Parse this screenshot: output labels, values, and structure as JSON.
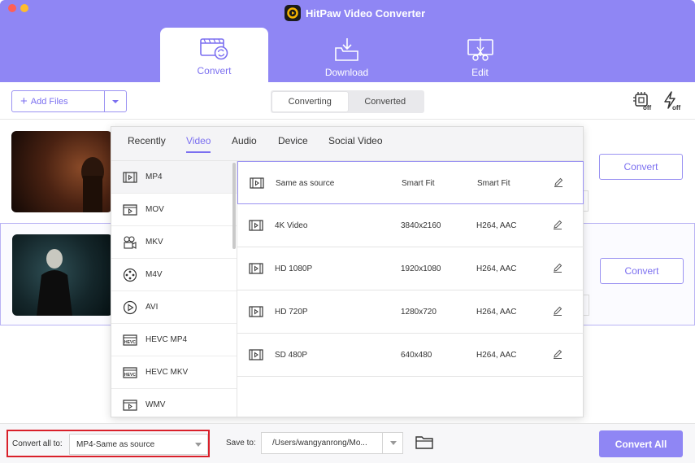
{
  "app": {
    "title": "HitPaw Video Converter"
  },
  "tabs": [
    {
      "label": "Convert",
      "icon": "convert-icon",
      "active": true
    },
    {
      "label": "Download",
      "icon": "download-icon",
      "active": false
    },
    {
      "label": "Edit",
      "icon": "edit-icon",
      "active": false
    }
  ],
  "toolbar": {
    "add_files": "Add Files",
    "segments": [
      "Converting",
      "Converted"
    ],
    "hw_accel_icon": "hardware-acceleration-off-icon",
    "turbo_icon": "turbo-off-icon",
    "icon_badges": [
      "off",
      "off"
    ]
  },
  "files": [
    {
      "convert_label": "Convert"
    },
    {
      "convert_label": "Convert"
    }
  ],
  "format_popup": {
    "tabs": [
      "Recently",
      "Video",
      "Audio",
      "Device",
      "Social Video"
    ],
    "active_tab": "Video",
    "formats": [
      "MP4",
      "MOV",
      "MKV",
      "M4V",
      "AVI",
      "HEVC MP4",
      "HEVC MKV",
      "WMV"
    ],
    "active_format": "MP4",
    "presets": [
      {
        "name": "Same as source",
        "resolution": "Smart Fit",
        "codec": "Smart Fit"
      },
      {
        "name": "4K Video",
        "resolution": "3840x2160",
        "codec": "H264, AAC"
      },
      {
        "name": "HD 1080P",
        "resolution": "1920x1080",
        "codec": "H264, AAC"
      },
      {
        "name": "HD 720P",
        "resolution": "1280x720",
        "codec": "H264, AAC"
      },
      {
        "name": "SD 480P",
        "resolution": "640x480",
        "codec": "H264, AAC"
      }
    ]
  },
  "bottom": {
    "convert_all_to_label": "Convert all to:",
    "convert_all_to_value": "MP4-Same as source",
    "save_to_label": "Save to:",
    "save_to_path": "/Users/wangyanrong/Mo...",
    "convert_all_button": "Convert All"
  },
  "colors": {
    "accent": "#8f86f4",
    "highlight_border": "#d9202a"
  }
}
